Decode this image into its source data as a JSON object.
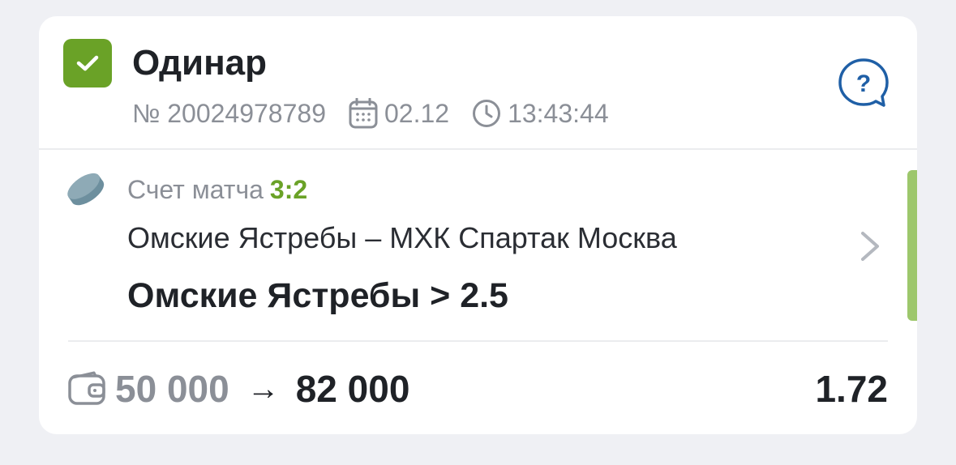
{
  "colors": {
    "accent_green": "#6aa227",
    "side_bar_green": "#9dc76c",
    "help_blue": "#1f5fa6",
    "muted_text": "#8b8f97"
  },
  "header": {
    "status_icon": "check-icon",
    "title": "Одинар",
    "help_icon": "question-bubble-icon",
    "bet_number": "№ 20024978789",
    "date_icon": "calendar-icon",
    "date": "02.12",
    "time_icon": "clock-icon",
    "time": "13:43:44"
  },
  "bet": {
    "sport_icon": "hockey-puck-icon",
    "score_label": "Счет матча",
    "score": "3:2",
    "match": "Омские Ястребы – МХК Спартак Москва",
    "selection": "Омские Ястребы > 2.5",
    "chevron_icon": "chevron-right-icon"
  },
  "footer": {
    "wallet_icon": "wallet-icon",
    "stake": "50 000",
    "arrow": "→",
    "payout": "82 000",
    "odds": "1.72"
  }
}
